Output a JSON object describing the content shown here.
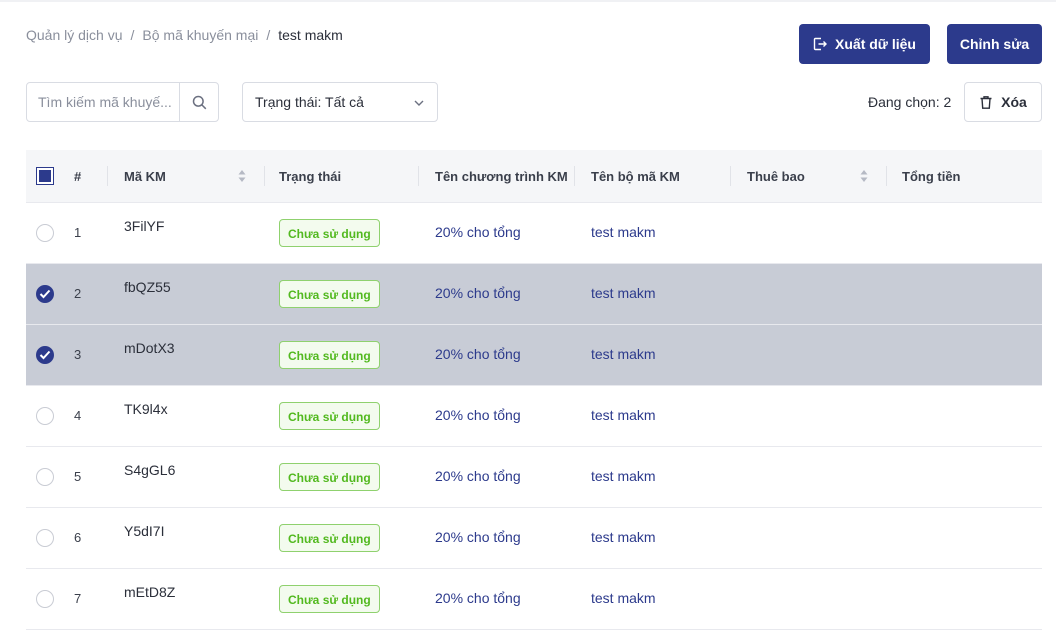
{
  "breadcrumb": {
    "items": [
      "Quản lý dịch vụ",
      "Bộ mã khuyến mại"
    ],
    "current": "test makm",
    "separator": "/"
  },
  "header": {
    "export_label": "Xuất dữ liệu",
    "edit_label": "Chỉnh sửa"
  },
  "toolbar": {
    "search_placeholder": "Tìm kiếm mã khuyế...",
    "status_filter": "Trạng thái: Tất cả",
    "selected_count": "Đang chọn: 2",
    "delete_label": "Xóa"
  },
  "table": {
    "columns": [
      "#",
      "Mã KM",
      "Trạng thái",
      "Tên chương trình KM",
      "Tên bộ mã KM",
      "Thuê bao",
      "Tổng tiền"
    ],
    "rows": [
      {
        "index": "1",
        "code": "3FilYF",
        "status": "Chưa sử dụng",
        "program": "20% cho tổng",
        "set": "test makm",
        "selected": false
      },
      {
        "index": "2",
        "code": "fbQZ55",
        "status": "Chưa sử dụng",
        "program": "20% cho tổng",
        "set": "test makm",
        "selected": true
      },
      {
        "index": "3",
        "code": "mDotX3",
        "status": "Chưa sử dụng",
        "program": "20% cho tổng",
        "set": "test makm",
        "selected": true
      },
      {
        "index": "4",
        "code": "TK9l4x",
        "status": "Chưa sử dụng",
        "program": "20% cho tổng",
        "set": "test makm",
        "selected": false
      },
      {
        "index": "5",
        "code": "S4gGL6",
        "status": "Chưa sử dụng",
        "program": "20% cho tổng",
        "set": "test makm",
        "selected": false
      },
      {
        "index": "6",
        "code": "Y5dI7I",
        "status": "Chưa sử dụng",
        "program": "20% cho tổng",
        "set": "test makm",
        "selected": false
      },
      {
        "index": "7",
        "code": "mEtD8Z",
        "status": "Chưa sử dụng",
        "program": "20% cho tổng",
        "set": "test makm",
        "selected": false
      }
    ]
  },
  "colors": {
    "primary": "#2c3a8c",
    "badge_green": "#52b91f",
    "selected_row": "#c8ccd6"
  }
}
